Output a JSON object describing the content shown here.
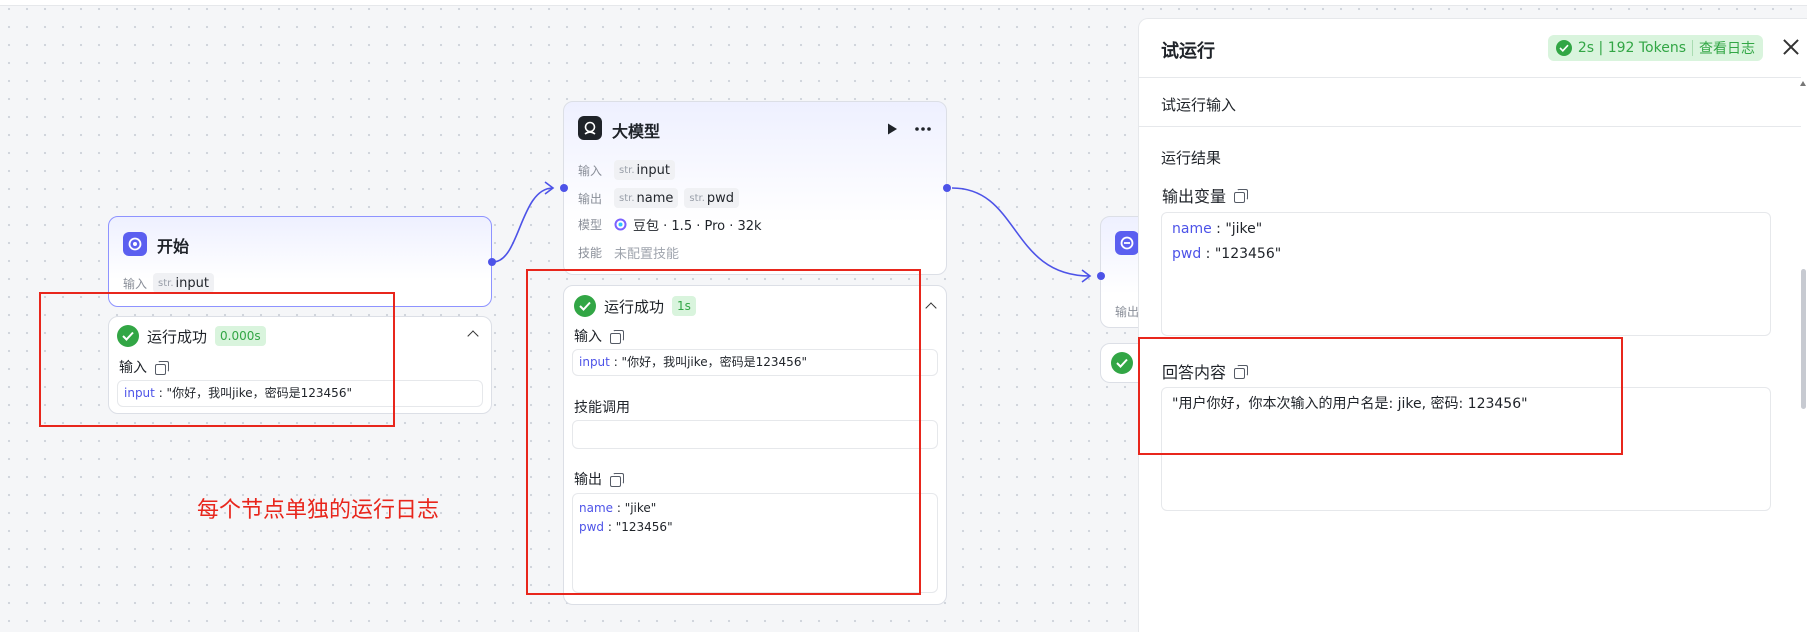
{
  "canvas": {
    "annotation": "每个节点单独的运行日志"
  },
  "start_node": {
    "title": "开始",
    "input_label": "输入",
    "input_type": "str.",
    "input_name": "input",
    "status": "运行成功",
    "duration": "0.000s",
    "section_input": "输入",
    "input_key": "input",
    "input_value": "\"你好，我叫jike，密码是123456\""
  },
  "llm_node": {
    "title": "大模型",
    "input_label": "输入",
    "input_type": "str.",
    "input_name": "input",
    "output_label": "输出",
    "outputs": [
      {
        "type": "str.",
        "name": "name"
      },
      {
        "type": "str.",
        "name": "pwd"
      }
    ],
    "model_label": "模型",
    "model_value": "豆包 · 1.5 · Pro · 32k",
    "skill_label": "技能",
    "skill_value": "未配置技能",
    "status": "运行成功",
    "duration": "1s",
    "section_input": "输入",
    "input_key": "input",
    "input_value": "\"你好，我叫jike，密码是123456\"",
    "section_skill": "技能调用",
    "section_output": "输出",
    "output_lines": [
      {
        "key": "name",
        "value": "\"jike\""
      },
      {
        "key": "pwd",
        "value": "\"123456\""
      }
    ]
  },
  "end_node": {
    "output_label": "输出"
  },
  "panel": {
    "title": "试运行",
    "badge_text": "2s | 192 Tokens",
    "badge_link": "查看日志",
    "input_section": "试运行输入",
    "result_section": "运行结果",
    "output_vars_label": "输出变量",
    "output_vars": [
      {
        "key": "name",
        "value": "\"jike\""
      },
      {
        "key": "pwd",
        "value": "\"123456\""
      }
    ],
    "answer_label": "回答内容",
    "answer_value": "\"用户你好，你本次输入的用户名是: jike, 密码: 123456\""
  },
  "colors": {
    "accent": "#4d53e8",
    "success": "#32a645",
    "annotation_red": "#e8261c"
  }
}
